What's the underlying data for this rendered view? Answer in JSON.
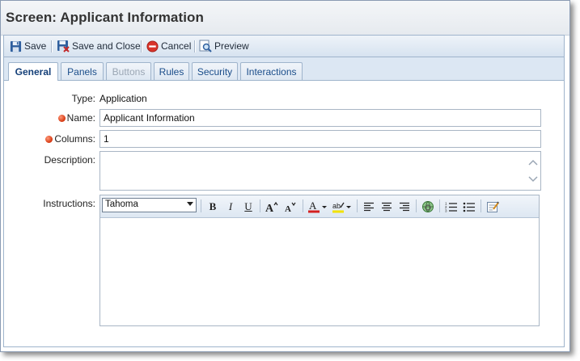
{
  "window": {
    "title": "Screen: Applicant Information"
  },
  "toolbar": {
    "save_label": "Save",
    "save_close_label": "Save and Close",
    "cancel_label": "Cancel",
    "preview_label": "Preview"
  },
  "tabs": [
    {
      "label": "General",
      "state": "active"
    },
    {
      "label": "Panels",
      "state": "normal"
    },
    {
      "label": "Buttons",
      "state": "disabled"
    },
    {
      "label": "Rules",
      "state": "normal"
    },
    {
      "label": "Security",
      "state": "normal"
    },
    {
      "label": "Interactions",
      "state": "normal"
    }
  ],
  "form": {
    "type_label": "Type:",
    "type_value": "Application",
    "name_label": "Name:",
    "name_value": "Applicant Information",
    "columns_label": "Columns:",
    "columns_value": "1",
    "description_label": "Description:",
    "description_value": "",
    "instructions_label": "Instructions:"
  },
  "editor": {
    "font_value": "Tahoma",
    "font_options_visible": [
      "Tahoma"
    ],
    "buttons": [
      "bold",
      "italic",
      "underline",
      "grow-font",
      "shrink-font",
      "font-color",
      "highlight-color",
      "align-left",
      "align-center",
      "align-right",
      "insert-link",
      "ordered-list",
      "unordered-list",
      "format-html"
    ],
    "font_color": "#d42020",
    "highlight_color": "#f2e200",
    "content": ""
  },
  "colors": {
    "accent": "#1a4d8a",
    "required_marker": "#d83b14",
    "toolbar_bg": "#dce7f3"
  }
}
